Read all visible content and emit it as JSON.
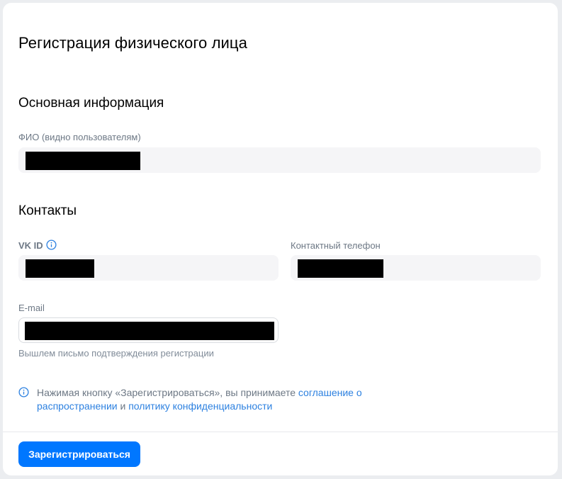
{
  "page": {
    "title": "Регистрация физического лица"
  },
  "basic_info": {
    "section_title": "Основная информация",
    "fio_label": "ФИО (видно пользователям)"
  },
  "contacts": {
    "section_title": "Контакты",
    "vkid_label": "VK ID",
    "phone_label": "Контактный телефон",
    "email_label": "E-mail",
    "email_hint": "Вышлем письмо подтверждения регистрации"
  },
  "agreement": {
    "prefix": "Нажимая кнопку «Зарегистрироваться», вы принимаете ",
    "link1": "соглашение о распространении",
    "middle": " и ",
    "link2": "политику конфиденциальности"
  },
  "footer": {
    "register_label": "Зарегистрироваться"
  },
  "icons": {
    "info": "info-circle-icon"
  },
  "colors": {
    "accent": "#0077ff",
    "link": "#2d81e0",
    "secondary_text": "#6d7885"
  }
}
